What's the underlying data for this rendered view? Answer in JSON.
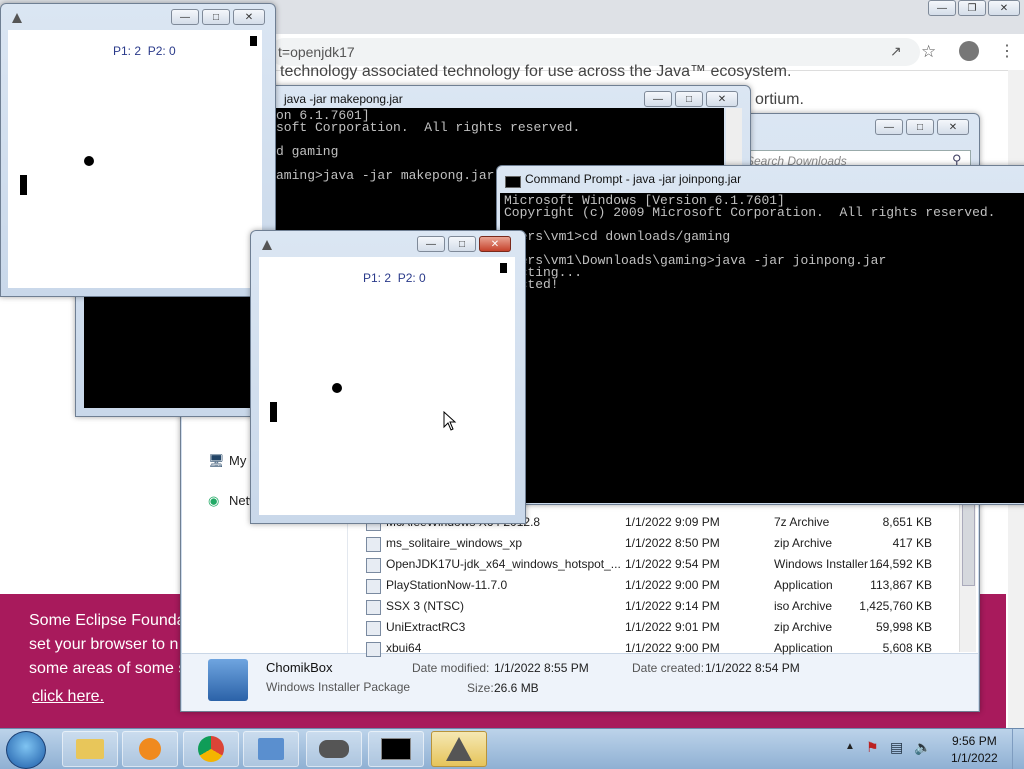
{
  "browser": {
    "url_fragment": "t=openjdk17",
    "page_text_line1": "technology associated technology for use across the Java™ ecosystem.",
    "page_text_line2": "ortium."
  },
  "cookie_banner": {
    "line1": "Some Eclipse Founda",
    "line2": "set your browser to n",
    "line3": "some areas of some s",
    "link": "click here.",
    "bg_color": "#a81a5c"
  },
  "explorer": {
    "search_placeholder": "Search Downloads",
    "nav_items": [
      "My",
      "Netw"
    ],
    "files": [
      {
        "name": "McAfeeWindows X64 2012.8",
        "date": "1/1/2022 9:09 PM",
        "type": "7z Archive",
        "size": "8,651 KB"
      },
      {
        "name": "ms_solitaire_windows_xp",
        "date": "1/1/2022 8:50 PM",
        "type": "zip Archive",
        "size": "417 KB"
      },
      {
        "name": "OpenJDK17U-jdk_x64_windows_hotspot_...",
        "date": "1/1/2022 9:54 PM",
        "type": "Windows Installer ...",
        "size": "164,592 KB"
      },
      {
        "name": "PlayStationNow-11.7.0",
        "date": "1/1/2022 9:00 PM",
        "type": "Application",
        "size": "113,867 KB"
      },
      {
        "name": "SSX 3 (NTSC)",
        "date": "1/1/2022 9:14 PM",
        "type": "iso Archive",
        "size": "1,425,760 KB"
      },
      {
        "name": "UniExtractRC3",
        "date": "1/1/2022 9:01 PM",
        "type": "zip Archive",
        "size": "59,998 KB"
      },
      {
        "name": "xbui64",
        "date": "1/1/2022 9:00 PM",
        "type": "Application",
        "size": "5,608 KB"
      }
    ],
    "details": {
      "name": "ChomikBox",
      "type": "Windows Installer Package",
      "modified_label": "Date modified:",
      "modified": "1/1/2022 8:55 PM",
      "created_label": "Date created:",
      "created": "1/1/2022 8:54 PM",
      "size_label": "Size:",
      "size": "26.6 MB"
    }
  },
  "cmd_make": {
    "title": "java  -jar makepong.jar",
    "lines": [
      "on 6.1.7601]",
      "soft Corporation.  All rights reserved.",
      "",
      "d gaming",
      "",
      "aming>java -jar makepong.jar"
    ]
  },
  "cmd_join": {
    "title": "Command Prompt - java  -jar joinpong.jar",
    "lines": [
      "Microsoft Windows [Version 6.1.7601]",
      "Copyright (c) 2009 Microsoft Corporation.  All rights reserved.",
      "",
      "Users\\vm1>cd downloads/gaming",
      "",
      "Users\\vm1\\Downloads\\gaming>java -jar joinpong.jar",
      "necting...",
      "nected!"
    ]
  },
  "pong1": {
    "score": "P1: 2  P2: 0"
  },
  "pong2": {
    "score": "P1: 2  P2: 0"
  },
  "tray": {
    "time": "9:56 PM",
    "date": "1/1/2022"
  }
}
